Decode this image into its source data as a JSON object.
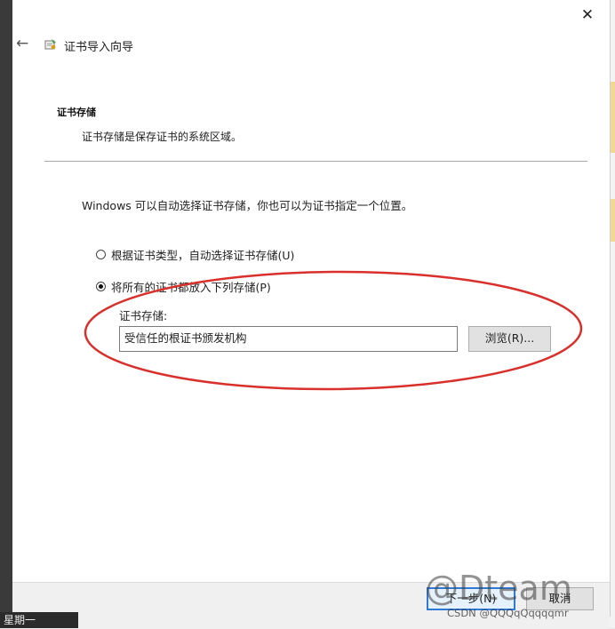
{
  "dialog": {
    "title": "证书导入向导",
    "close_icon": "close-icon",
    "back_icon": "arrow-left-icon",
    "wizard_icon": "certificate-wizard-icon"
  },
  "section": {
    "heading": "证书存储",
    "description": "证书存储是保存证书的系统区域。"
  },
  "intro": "Windows 可以自动选择证书存储，你也可以为证书指定一个位置。",
  "options": [
    {
      "label": "根据证书类型，自动选择证书存储(U)",
      "checked": false
    },
    {
      "label": "将所有的证书都放入下列存储(P)",
      "checked": true
    }
  ],
  "store": {
    "label": "证书存储:",
    "value": "受信任的根证书颁发机构",
    "browse_label": "浏览(R)..."
  },
  "footer": {
    "next_label": "下一步(N)",
    "cancel_label": "取消"
  },
  "annotation": {
    "color": "#d9302c",
    "shape": "ellipse"
  },
  "background": {
    "taskbar_text": "星期一"
  },
  "watermark": {
    "logo": "@Dteam",
    "text": "CSDN @QQQqQqqqqmr"
  }
}
